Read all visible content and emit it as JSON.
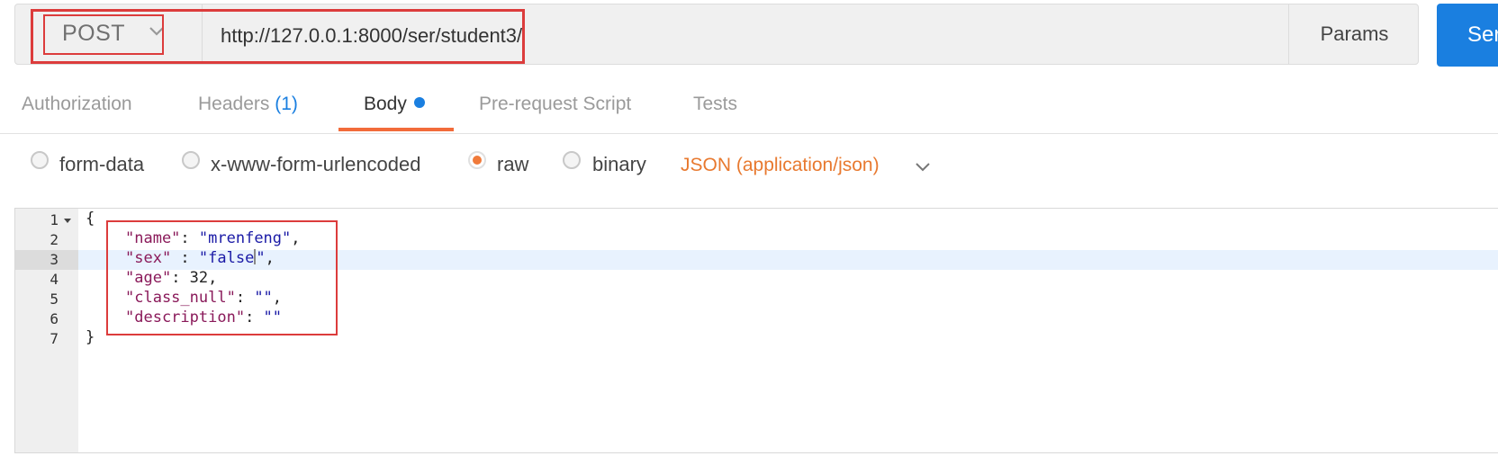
{
  "request": {
    "method": "POST",
    "url": "http://127.0.0.1:8000/ser/student3/",
    "params_label": "Params",
    "send_label": "Ser"
  },
  "tabs": [
    {
      "label": "Authorization"
    },
    {
      "label": "Headers",
      "count": "(1)"
    },
    {
      "label": "Body",
      "active": true,
      "modified_dot": true
    },
    {
      "label": "Pre-request Script"
    },
    {
      "label": "Tests"
    }
  ],
  "body_types": {
    "options": [
      "form-data",
      "x-www-form-urlencoded",
      "raw",
      "binary"
    ],
    "selected": "raw",
    "content_type": "JSON (application/json)"
  },
  "editor": {
    "line_numbers": [
      "1",
      "2",
      "3",
      "4",
      "5",
      "6",
      "7"
    ],
    "active_line": 3,
    "lines": [
      "{",
      "    \"name\": \"mrenfeng\",",
      "    \"sex\" : \"false\",",
      "    \"age\": 32,",
      "    \"class_null\": \"\",",
      "    \"description\": \"\"",
      "}"
    ],
    "tokens": {
      "l1": "{",
      "l2_key": "\"name\"",
      "l2_sep": ": ",
      "l2_val": "\"mrenfeng\"",
      "l2_end": ",",
      "l3_key": "\"sex\"",
      "l3_sep": " : ",
      "l3_val_a": "\"false",
      "l3_val_b": "\"",
      "l3_end": ",",
      "l4_key": "\"age\"",
      "l4_sep": ": ",
      "l4_val": "32",
      "l4_end": ",",
      "l5_key": "\"class_null\"",
      "l5_sep": ": ",
      "l5_val": "\"\"",
      "l5_end": ",",
      "l6_key": "\"description\"",
      "l6_sep": ": ",
      "l6_val": "\"\"",
      "l7": "}"
    }
  },
  "colors": {
    "accent_blue": "#1a7fe0",
    "accent_orange": "#f26b3a",
    "highlight_red": "#dc3c3c"
  }
}
